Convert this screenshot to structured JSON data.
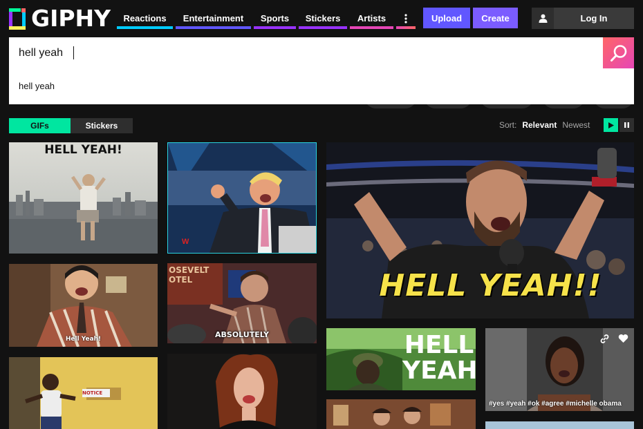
{
  "header": {
    "logo_text": "GIPHY",
    "nav": [
      {
        "label": "Reactions",
        "color": "#00ccff"
      },
      {
        "label": "Entertainment",
        "color": "#6157ff"
      },
      {
        "label": "Sports",
        "color": "#9933ff"
      },
      {
        "label": "Stickers",
        "color": "#9933ff"
      },
      {
        "label": "Artists",
        "color": "#e646b6"
      }
    ],
    "more_icon": "vertical-dots-icon",
    "upload_label": "Upload",
    "create_label": "Create",
    "login_label": "Log In",
    "user_icon": "user-icon"
  },
  "search": {
    "value": "hell yeah",
    "suggestion": "hell yeah",
    "icon": "magnifier-icon"
  },
  "tabs": {
    "gifs": "GIFs",
    "stickers": "Stickers"
  },
  "sort": {
    "label": "Sort:",
    "relevant": "Relevant",
    "newest": "Newest",
    "play_icon": "play-icon",
    "pause_icon": "pause-icon"
  },
  "tiles": {
    "t1_caption": "HELL YEAH!",
    "t3_caption": "Hell Yeah!",
    "t4_caption": "ABSOLUTELY",
    "t4_sign": "OSEVELT\nOTEL",
    "t7_caption": "HELL YEAH!!",
    "t8_caption_1": "HELL",
    "t8_caption_2": "YEAH",
    "t9_tags": "#yes #yeah #ok #agree #michelle obama",
    "t9_link_icon": "link-icon",
    "t9_heart_icon": "heart-icon",
    "t5_sign": "NOTICE"
  },
  "colors": {
    "accent_green": "#00e6a0",
    "search_gradient_start": "#ff6666",
    "search_gradient_end": "#e646b6",
    "upload": "#6157ff",
    "create": "#7b5cff"
  }
}
